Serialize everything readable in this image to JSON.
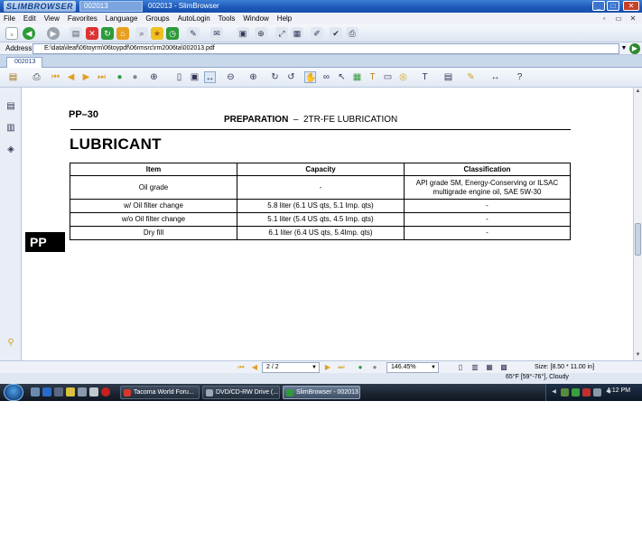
{
  "window": {
    "brand": "SLIMBROWSER",
    "tab_title": "002013",
    "title": "002013 - SlimBrowser",
    "minimize": "_",
    "maximize": "□",
    "close": "✕"
  },
  "menu": [
    "File",
    "Edit",
    "View",
    "Favorites",
    "Language",
    "Groups",
    "AutoLogin",
    "Tools",
    "Window",
    "Help"
  ],
  "address": {
    "label": "Address",
    "value": "E:\\data\\ileaf\\06toyrm\\06toypdf\\06rmsrc\\rm2006ta\\002013.pdf"
  },
  "doc_tab": "002013",
  "document": {
    "page_code": "PP–30",
    "header_bold": "PREPARATION",
    "header_rest": "  –  2TR-FE LUBRICATION",
    "section_title": "LUBRICANT",
    "side_tab": "PP",
    "table": {
      "headers": [
        "Item",
        "Capacity",
        "Classification"
      ],
      "rows": [
        [
          "Oil grade",
          "-",
          "API grade SM, Energy-Conserving or ILSAC multigrade engine oil, SAE 5W-30"
        ],
        [
          "w/ Oil filter change",
          "5.8 liter (6.1 US qts, 5.1 Imp. qts)",
          "-"
        ],
        [
          "w/o Oil filter change",
          "5.1 liter (5.4 US qts, 4.5 Imp. qts)",
          "-"
        ],
        [
          "Dry fill",
          "6.1 liter (6.4 US qts, 5.4Imp. qts)",
          "-"
        ]
      ]
    }
  },
  "status": {
    "page": "2 / 2",
    "zoom": "146.45%",
    "size": "Size: [8.50 * 11.00 in]",
    "weather": "65°F [59°-76°], Cloudy"
  },
  "taskbar": {
    "tasks": [
      "Tacoma World Foru...",
      "DVD/CD-RW Drive (...",
      "SlimBrowser - 002013"
    ],
    "clock": "4:12 PM"
  },
  "colors": {
    "titlebar": "#1c58b8",
    "taskbar": "#0e1620",
    "go_button": "#2c8a2c"
  }
}
